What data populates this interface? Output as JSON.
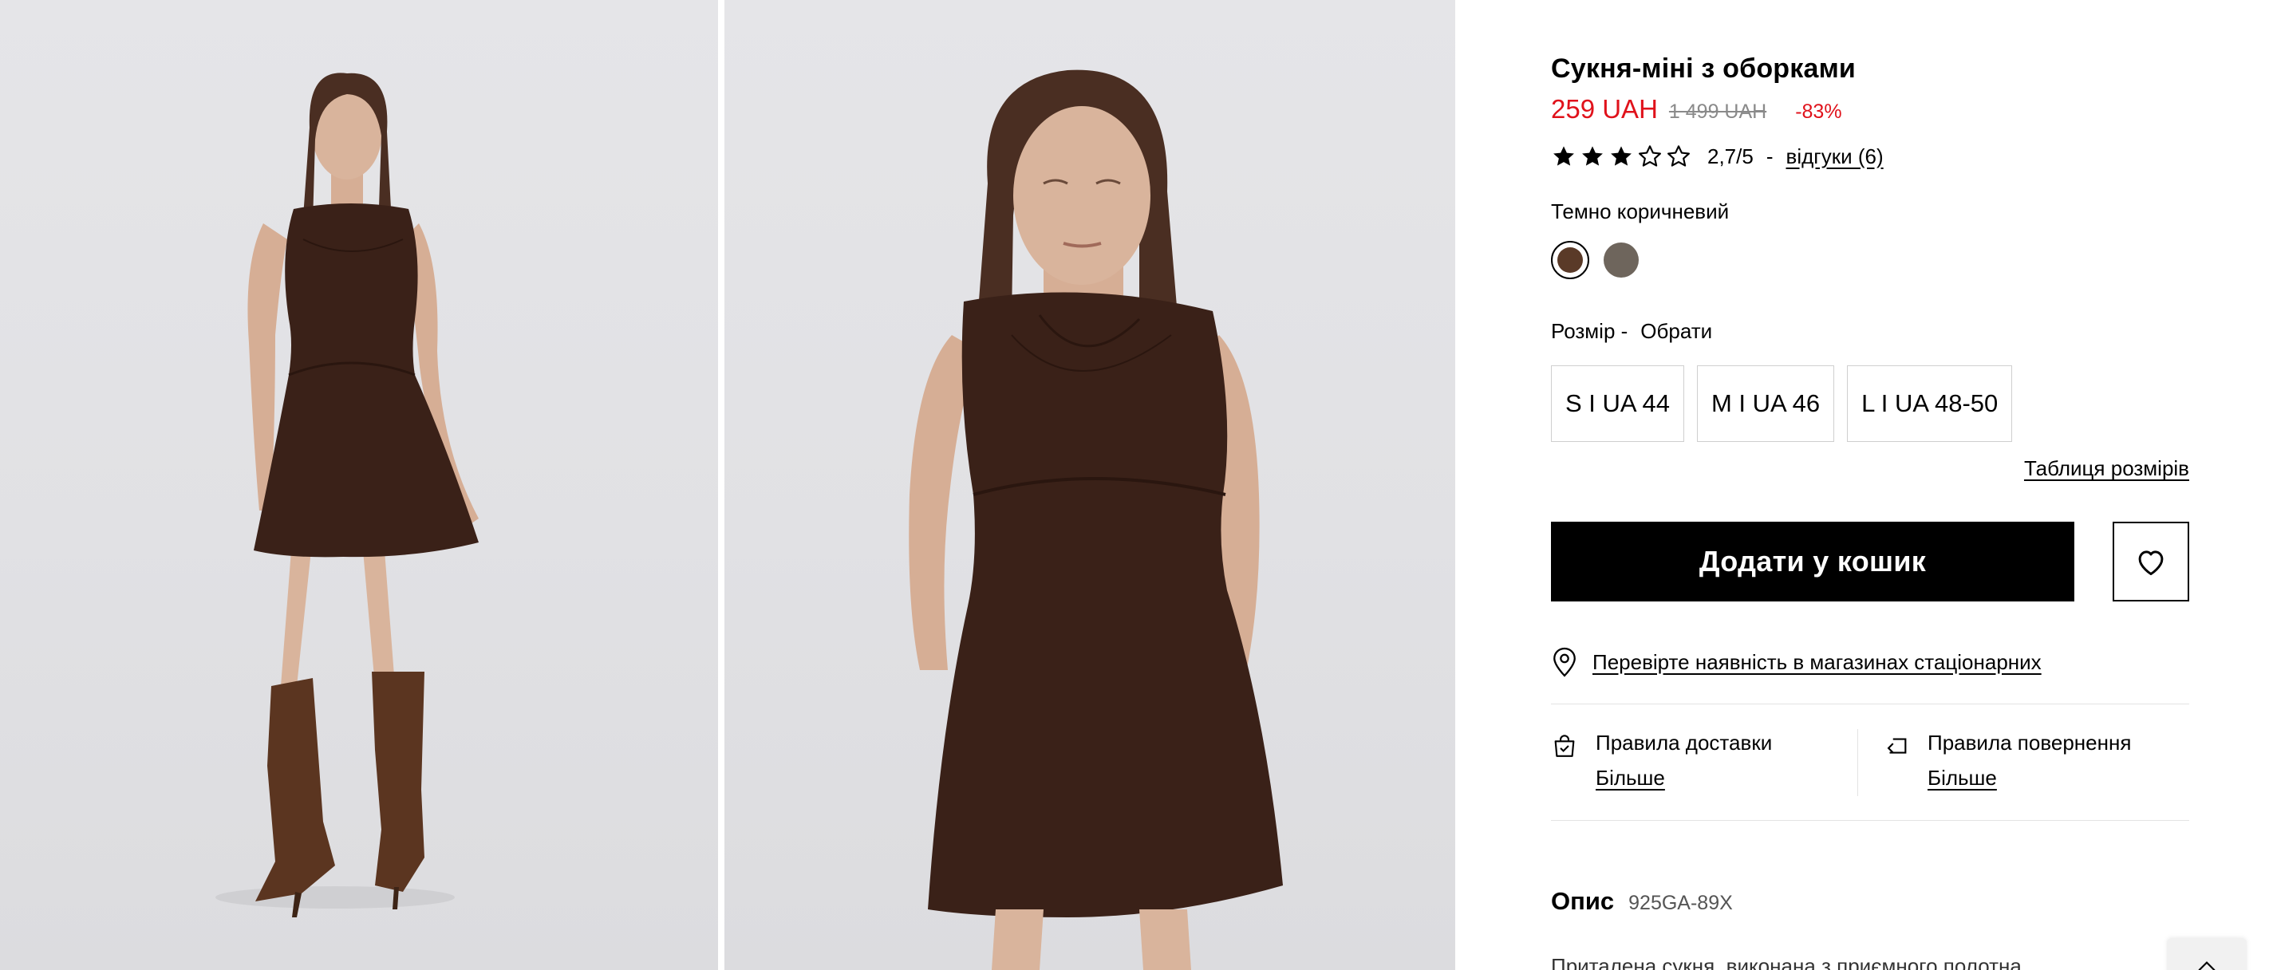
{
  "product": {
    "title": "Сукня-міні з оборками",
    "price_current": "259 UAH",
    "price_old": "1 499 UAH",
    "discount": "-83%",
    "rating": {
      "stars_filled": 3,
      "stars_total": 5,
      "value_text": "2,7/5",
      "separator": "-",
      "reviews_link": "відгуки (6)"
    },
    "color": {
      "name": "Темно коричневий",
      "swatches": [
        {
          "hex": "#5a3a28",
          "selected": true
        },
        {
          "hex": "#6e655c",
          "selected": false
        }
      ]
    },
    "size": {
      "label": "Розмір -",
      "selection": "Обрати",
      "options": [
        "S I UA 44",
        "M I UA 46",
        "L I UA 48-50"
      ],
      "size_table_link": "Таблиця розмірів"
    },
    "add_to_cart_label": "Додати у кошик",
    "store_availability_link": "Перевірте наявність в магазинах стаціонарних",
    "policies": {
      "delivery_title": "Правила доставки",
      "delivery_more": "Більше",
      "return_title": "Правила повернення",
      "return_more": "Більше"
    },
    "description": {
      "title": "Опис",
      "code": "925GA-89X",
      "text_partial": "Приталена сукня, виконана з приємного полотна..."
    }
  },
  "gallery": {
    "images": [
      "model-full-length-photo",
      "model-close-up-photo"
    ],
    "dress_color": "#3a2118",
    "background_color": "#e3e3e6"
  },
  "colors": {
    "accent_red": "#e0121b",
    "button_black": "#000000"
  }
}
